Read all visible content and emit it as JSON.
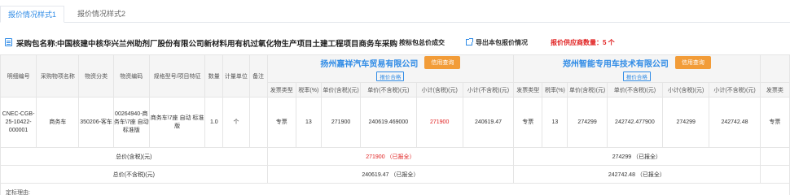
{
  "tabs": [
    {
      "label": "报价情况样式1",
      "active": true
    },
    {
      "label": "报价情况样式2",
      "active": false
    }
  ],
  "header": {
    "package_label": "采购包名称:",
    "package_name": "中国核建中核华兴兰州助剂厂股份有限公司新材料用有机过氧化物生产项目土建工程项目商务车采购",
    "deal_mode": "按标包总价成交",
    "export_link": "导出本包报价情况",
    "supplier_count": "报价供应商数量：5 个"
  },
  "columns": [
    "明细编号",
    "采购物项名称",
    "物资分类",
    "物资编码",
    "规格型号/项目特征",
    "数量",
    "计量单位",
    "备注"
  ],
  "vendors": [
    {
      "name": "扬州嘉祥汽车贸易有限公司",
      "credit_button": "信用查询",
      "qualified": "报价合格"
    },
    {
      "name": "郑州智能专用车技术有限公司",
      "credit_button": "信用查询",
      "qualified": "报价合格"
    }
  ],
  "vendor_columns": [
    "发票类型",
    "税率(%)",
    "单价(含税)(元)",
    "单价(不含税)(元)",
    "小计(含税)(元)",
    "小计(不含税)(元)"
  ],
  "vendor3_partial_column": "发票类",
  "row": {
    "detail_no": "CNEC-CGB-25-10422-000001",
    "item_name": "商务车",
    "category": "350206-客车",
    "material_code": "00264940-商务车\\7座 自动 标准版",
    "spec": "商务车\\7座 自动 标准版",
    "quantity": "1.0",
    "unit": "个",
    "remark": "",
    "vendor_quotes": [
      {
        "invoice_type": "专票",
        "tax_rate": "13",
        "unit_price_tax": "271900",
        "unit_price_notax": "240619.469000",
        "subtotal_tax": "271900",
        "subtotal_notax": "240619.47"
      },
      {
        "invoice_type": "专票",
        "tax_rate": "13",
        "unit_price_tax": "274299",
        "unit_price_notax": "242742.477900",
        "subtotal_tax": "274299",
        "subtotal_notax": "242742.48"
      }
    ],
    "vendor3_partial_invoice": "专票"
  },
  "totals": {
    "with_tax_label": "总价(含税)(元)",
    "without_tax_label": "总价(不含税)(元)",
    "vendor_with_tax": [
      "271900 （已报全）",
      "274299 （已报全）"
    ],
    "vendor_without_tax": [
      "240619.47 （已报全）",
      "242742.48 （已报全）"
    ]
  },
  "reason_label": "定标理由:",
  "colors": {
    "accent": "#2f8be6",
    "warning": "#e02020",
    "button": "#f29c38"
  }
}
